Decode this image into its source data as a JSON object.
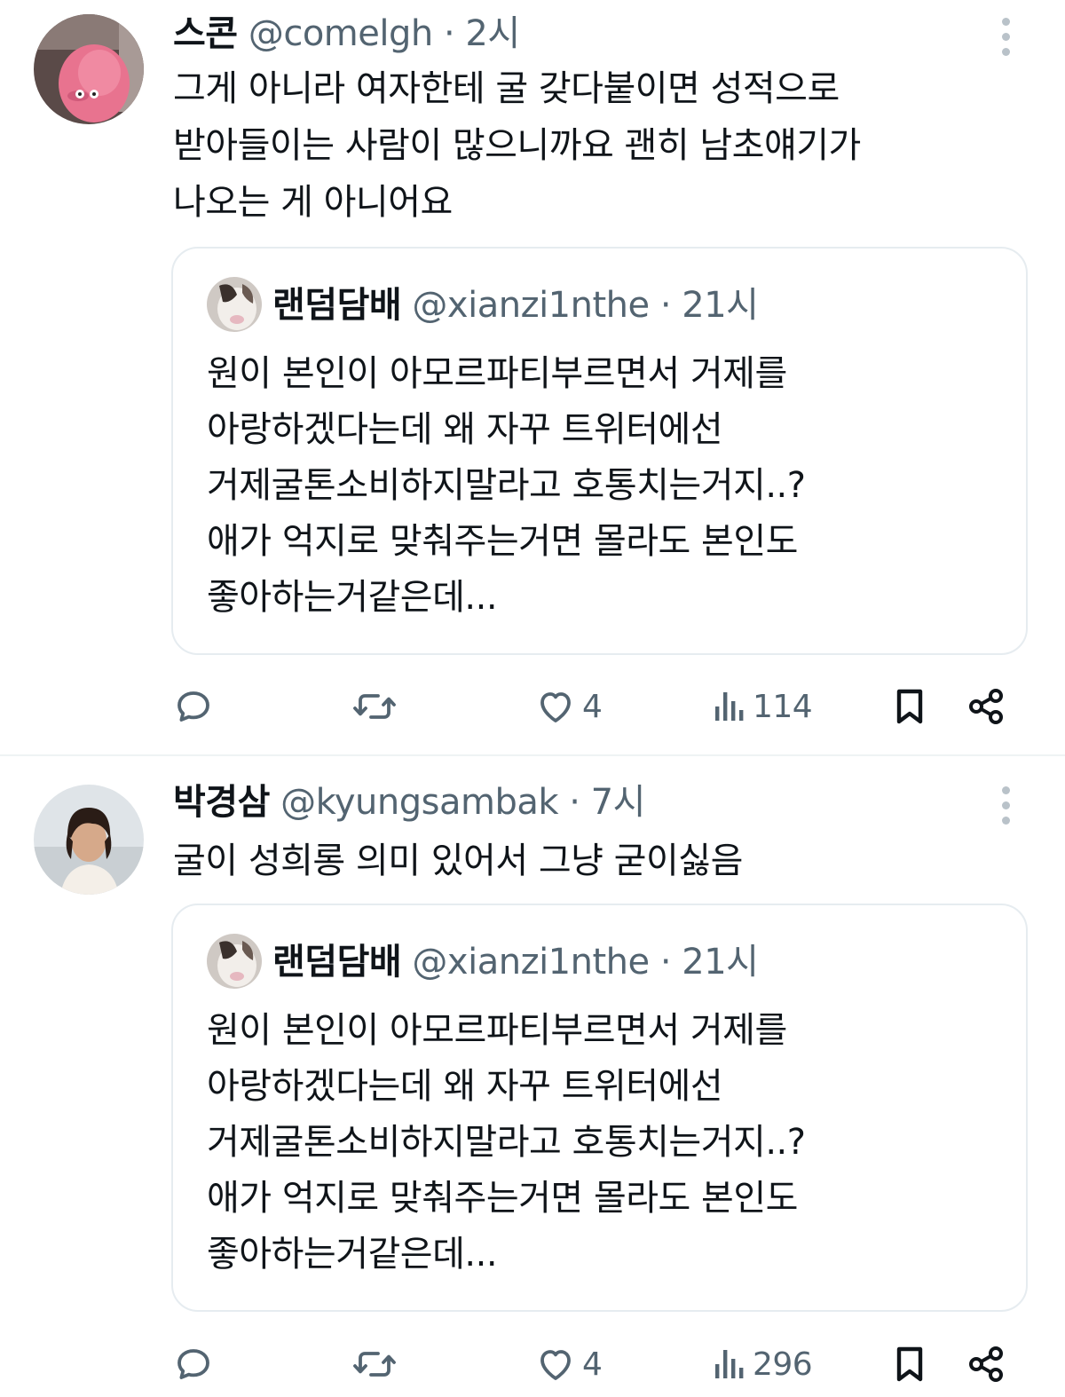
{
  "tweets": [
    {
      "author": {
        "name": "스콘",
        "handle": "@comelgh",
        "separator": "·",
        "time": "2시",
        "avatar_icon": "pink-cartoon-avatar"
      },
      "text": "그게 아니라 여자한테 굴 갖다붙이면 성적으로\n받아들이는 사람이 많으니까요 괜히 남초얘기가\n나오는 게 아니어요",
      "quote": {
        "name": "랜덤담배",
        "handle": "@xianzi1nthe",
        "separator": "·",
        "time": "21시",
        "text": "원이 본인이 아모르파티부르면서 거제를\n아랑하겠다는데 왜 자꾸 트위터에선\n거제굴톤소비하지말라고 호통치는거지..?\n애가 억지로 맞춰주는거면 몰라도 본인도\n좋아하는거같은데..."
      },
      "stats": {
        "likes": "4",
        "views": "114"
      }
    },
    {
      "author": {
        "name": "박경삼",
        "handle": "@kyungsambak",
        "separator": "·",
        "time": "7시",
        "avatar_icon": "man-photo-avatar"
      },
      "text": "굴이 성희롱 의미 있어서 그냥 굳이싫음",
      "quote": {
        "name": "랜덤담배",
        "handle": "@xianzi1nthe",
        "separator": "·",
        "time": "21시",
        "text": "원이 본인이 아모르파티부르면서 거제를\n아랑하겠다는데 왜 자꾸 트위터에선\n거제굴톤소비하지말라고 호통치는거지..?\n애가 억지로 맞춰주는거면 몰라도 본인도\n좋아하는거같은데..."
      },
      "stats": {
        "likes": "4",
        "views": "296"
      }
    }
  ],
  "colors": {
    "text": "#0f1419",
    "secondary": "#536471",
    "border": "#e6ecf0",
    "divider": "#eff3f4"
  }
}
